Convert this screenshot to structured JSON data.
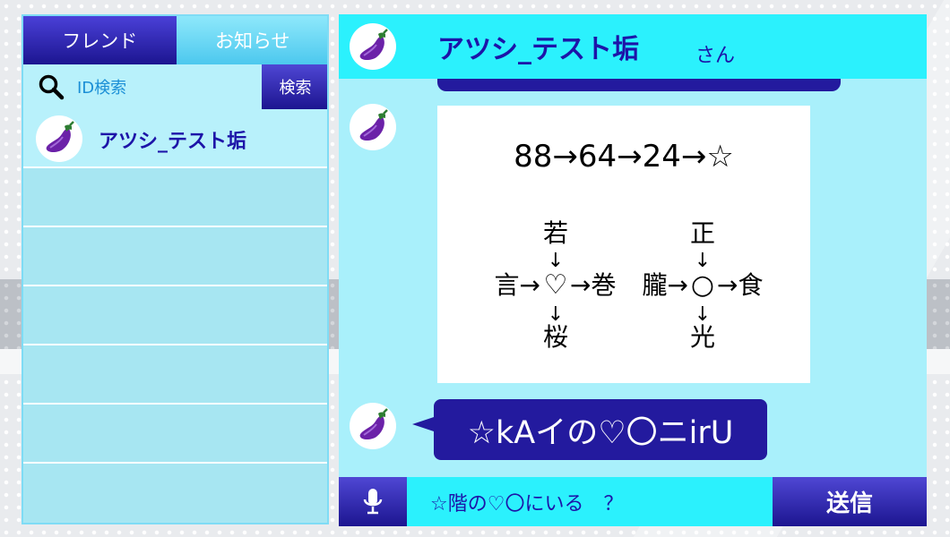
{
  "tabs": {
    "friends_label": "フレンド",
    "news_label": "お知らせ"
  },
  "search": {
    "placeholder": "ID検索",
    "button_label": "検索"
  },
  "friends": [
    {
      "name": "アツシ_テスト垢",
      "avatar_icon": "eggplant-icon"
    }
  ],
  "chat": {
    "title": "アツシ_テスト垢",
    "suffix": "さん",
    "image_message": {
      "line1": "88→64→24→☆",
      "puzzle_left": {
        "top": "若",
        "left": "言→",
        "center": "♡",
        "right": "→巻",
        "bottom": "桜",
        "arrow": "↓"
      },
      "puzzle_right": {
        "top": "正",
        "left": "朧→",
        "center": "○",
        "right": "→食",
        "bottom": "光",
        "arrow": "↓"
      }
    },
    "text_message": "☆kAイの♡〇ニirU",
    "input_value": "☆階の♡〇にいる　？",
    "send_label": "送信",
    "mic_icon": "microphone-icon"
  },
  "colors": {
    "accent": "#1d14a8",
    "panel": "#a9f0fb",
    "header": "#2bf1fd"
  }
}
